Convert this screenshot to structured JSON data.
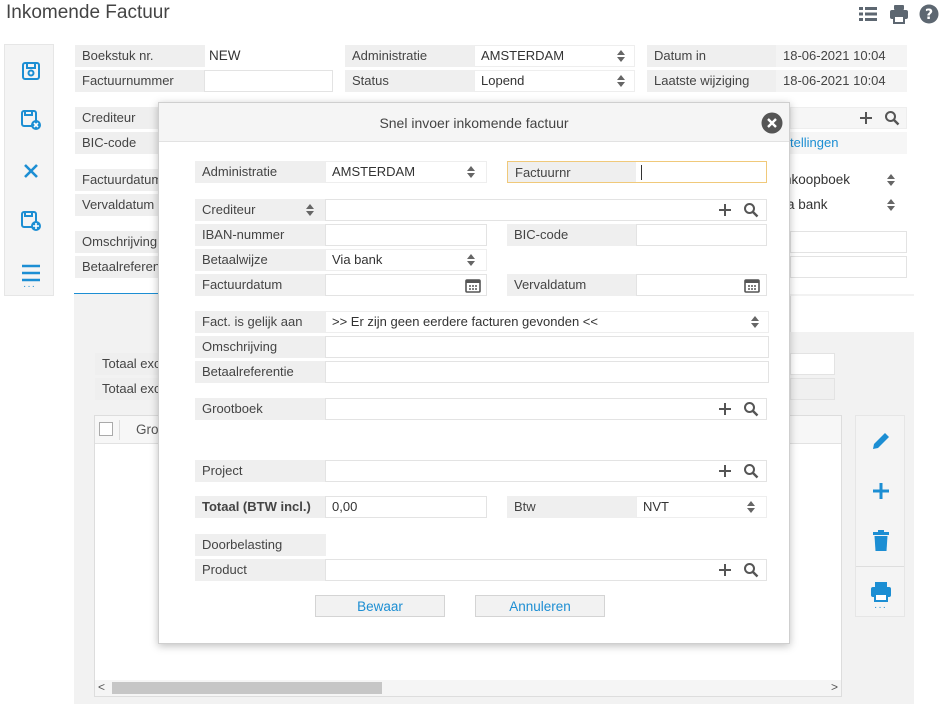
{
  "page": {
    "title": "Inkomende Factuur"
  },
  "header_icons": [
    "grid-icon",
    "print-icon",
    "help-icon"
  ],
  "form": {
    "boekstuk_label": "Boekstuk nr.",
    "boekstuk_value": "NEW",
    "factuurnummer_label": "Factuurnummer",
    "factuurnummer_value": "",
    "administratie_label": "Administratie",
    "administratie_value": "AMSTERDAM",
    "status_label": "Status",
    "status_value": "Lopend",
    "datum_in_label": "Datum in",
    "datum_in_value": "18-06-2021 10:04",
    "laatste_label": "Laatste wijziging",
    "laatste_value": "18-06-2021 10:04",
    "crediteur_label": "Crediteur",
    "bic_label": "BIC-code",
    "factuurdatum_label": "Factuurdatum",
    "vervaldatum_label": "Vervaldatum",
    "omschrijving_label": "Omschrijving",
    "betaalref_label": "Betaalreferentie",
    "link_text": "tellingen",
    "boek_value": "nkoopboek",
    "bank_value": "ia bank",
    "totaal1_label": "Totaal exc",
    "totaal2_label": "Totaal exc",
    "grid_col": "Gro"
  },
  "modal": {
    "title": "Snel invoer inkomende factuur",
    "administratie_label": "Administratie",
    "administratie_value": "AMSTERDAM",
    "factuurnr_label": "Factuurnr",
    "factuurnr_value": "",
    "crediteur_label": "Crediteur",
    "crediteur_value": "",
    "iban_label": "IBAN-nummer",
    "iban_value": "",
    "bic_label": "BIC-code",
    "bic_value": "",
    "betaalwijze_label": "Betaalwijze",
    "betaalwijze_value": "Via bank",
    "factuurdatum_label": "Factuurdatum",
    "factuurdatum_value": "",
    "vervaldatum_label": "Vervaldatum",
    "vervaldatum_value": "",
    "fact_gelijk_label": "Fact. is gelijk aan",
    "fact_gelijk_value": ">> Er zijn geen eerdere facturen gevonden <<",
    "omschrijving_label": "Omschrijving",
    "omschrijving_value": "",
    "betaalref_label": "Betaalreferentie",
    "betaalref_value": "",
    "grootboek_label": "Grootboek",
    "grootboek_value": "",
    "project_label": "Project",
    "project_value": "",
    "totaal_label": "Totaal (BTW incl.)",
    "totaal_value": "0,00",
    "btw_label": "Btw",
    "btw_value": "NVT",
    "doorbelasting_label": "Doorbelasting",
    "product_label": "Product",
    "product_value": "",
    "save_label": "Bewaar",
    "cancel_label": "Annuleren"
  },
  "colors": {
    "accent": "#1c8ed3",
    "label_bg": "#efefef",
    "focus_border": "#f0c97a"
  }
}
